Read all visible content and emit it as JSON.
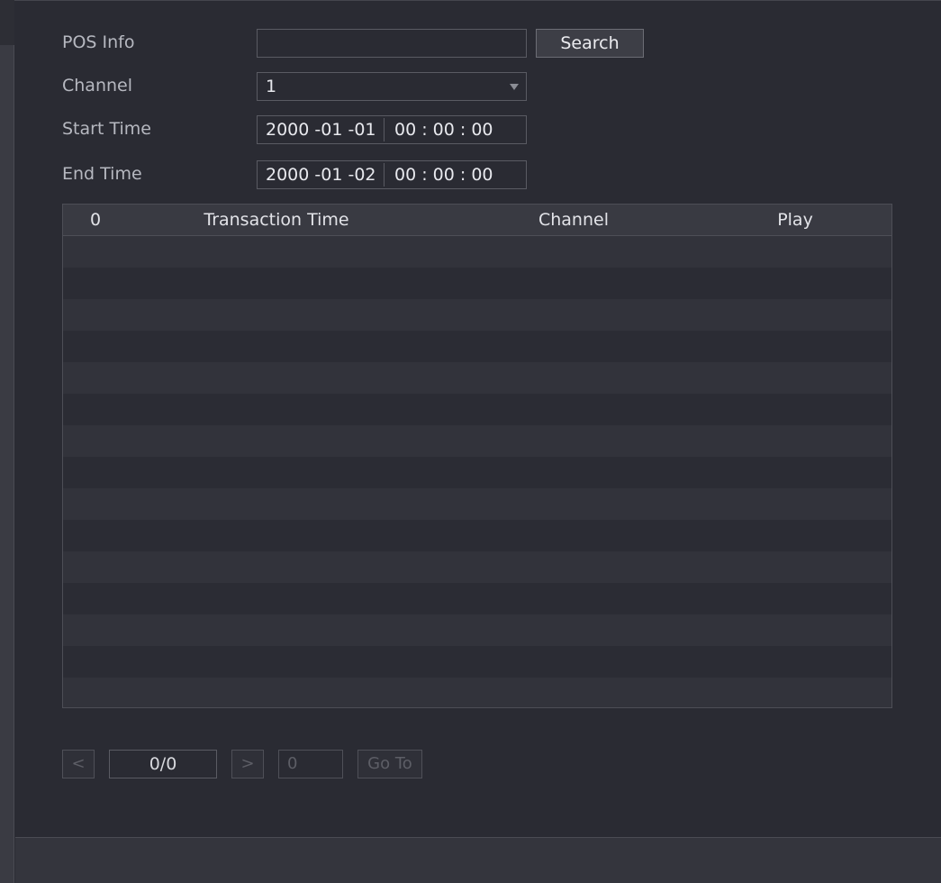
{
  "form": {
    "pos_info_label": "POS Info",
    "pos_info_value": "",
    "search_label": "Search",
    "channel_label": "Channel",
    "channel_value": "1",
    "start_time_label": "Start Time",
    "start_date": "2000 -01 -01",
    "start_time": "00 : 00 : 00",
    "end_time_label": "End Time",
    "end_date": "2000 -01 -02",
    "end_time": "00 : 00 : 00"
  },
  "table": {
    "columns": [
      "0",
      "Transaction Time",
      "Channel",
      "Play"
    ],
    "row_count": 15
  },
  "pager": {
    "prev_label": "<",
    "page_indicator": "0/0",
    "next_label": ">",
    "goto_value": "0",
    "goto_label": "Go To"
  }
}
